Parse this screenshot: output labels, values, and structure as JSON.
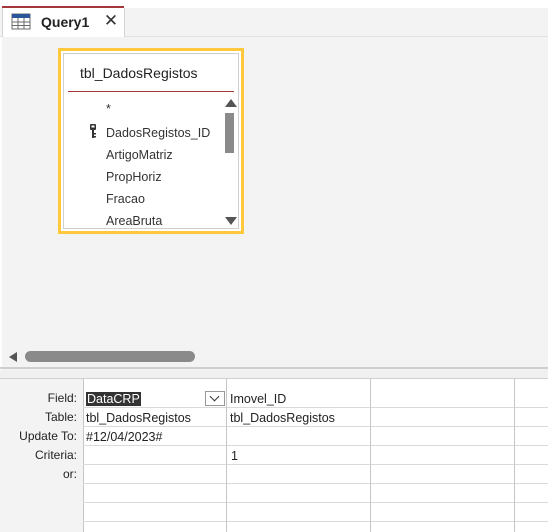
{
  "tab": {
    "label": "Query1",
    "close_glyph": "✕",
    "icon": "query-design-icon"
  },
  "table_window": {
    "title": "tbl_DadosRegistos",
    "fields": [
      {
        "name": "*",
        "key": false
      },
      {
        "name": "DadosRegistos_ID",
        "key": true
      },
      {
        "name": "ArtigoMatriz",
        "key": false
      },
      {
        "name": "PropHoriz",
        "key": false
      },
      {
        "name": "Fracao",
        "key": false
      },
      {
        "name": "AreaBruta",
        "key": false
      }
    ]
  },
  "grid": {
    "row_labels": {
      "field": "Field:",
      "table": "Table:",
      "update_to": "Update To:",
      "criteria": "Criteria:",
      "or": "or:"
    },
    "columns": [
      {
        "field": "DataCRP",
        "table": "tbl_DadosRegistos",
        "update_to": "#12/04/2023#",
        "criteria": ""
      },
      {
        "field": "Imovel_ID",
        "table": "tbl_DadosRegistos",
        "update_to": "",
        "criteria": "1"
      }
    ]
  },
  "colors": {
    "selection_border": "#ffc83d",
    "title_separator": "#a4373a",
    "accent_red": "#a4373a"
  }
}
